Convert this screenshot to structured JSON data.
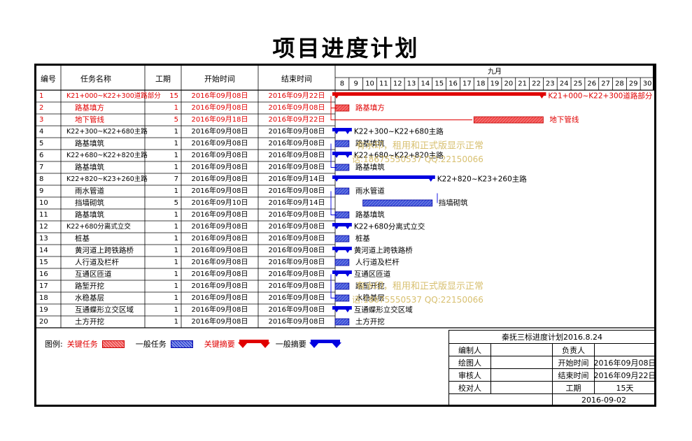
{
  "title": "项目进度计划",
  "headers": {
    "id": "编号",
    "name": "任务名称",
    "duration": "工期",
    "start": "开始时间",
    "end": "结束时间",
    "month": "九月"
  },
  "chart_data": {
    "type": "gantt",
    "days": [
      "8",
      "9",
      "10",
      "11",
      "12",
      "13",
      "14",
      "15",
      "16",
      "17",
      "18",
      "19",
      "20",
      "21",
      "22",
      "23",
      "24",
      "25",
      "26",
      "27",
      "28",
      "29",
      "30"
    ],
    "tasks": [
      {
        "id": "1",
        "name": "K21+000~K22+300道路部分",
        "duration": "15",
        "start": "2016年09月08日",
        "end": "2016年09月22日",
        "type": "critical-summary",
        "from": 8,
        "to": 22,
        "label": "K21+000~K22+300道路部分"
      },
      {
        "id": "2",
        "name": "路基填方",
        "duration": "1",
        "start": "2016年09月08日",
        "end": "2016年09月08日",
        "type": "critical",
        "from": 8,
        "to": 8,
        "label": "路基填方"
      },
      {
        "id": "3",
        "name": "地下管线",
        "duration": "5",
        "start": "2016年09月18日",
        "end": "2016年09月22日",
        "type": "critical",
        "from": 18,
        "to": 22,
        "label": "地下管线"
      },
      {
        "id": "4",
        "name": "K22+300~K22+680主路",
        "duration": "1",
        "start": "2016年09月08日",
        "end": "2016年09月08日",
        "type": "summary",
        "from": 8,
        "to": 8,
        "label": "K22+300~K22+680主路"
      },
      {
        "id": "5",
        "name": "路基填筑",
        "duration": "1",
        "start": "2016年09月08日",
        "end": "2016年09月08日",
        "type": "task",
        "from": 8,
        "to": 8,
        "label": "路基填筑"
      },
      {
        "id": "6",
        "name": "K22+680~K22+820主路",
        "duration": "1",
        "start": "2016年09月08日",
        "end": "2016年09月08日",
        "type": "summary",
        "from": 8,
        "to": 8,
        "label": "K22+680~K22+820主路"
      },
      {
        "id": "7",
        "name": "路基填筑",
        "duration": "1",
        "start": "2016年09月08日",
        "end": "2016年09月08日",
        "type": "task",
        "from": 8,
        "to": 8,
        "label": "路基填筑"
      },
      {
        "id": "8",
        "name": "K22+820~K23+260主路",
        "duration": "7",
        "start": "2016年09月08日",
        "end": "2016年09月14日",
        "type": "summary",
        "from": 8,
        "to": 14,
        "label": "K22+820~K23+260主路"
      },
      {
        "id": "9",
        "name": "雨水管道",
        "duration": "1",
        "start": "2016年09月08日",
        "end": "2016年09月08日",
        "type": "task",
        "from": 8,
        "to": 8,
        "label": "雨水管道"
      },
      {
        "id": "10",
        "name": "挡墙砌筑",
        "duration": "5",
        "start": "2016年09月10日",
        "end": "2016年09月14日",
        "type": "task",
        "from": 10,
        "to": 14,
        "label": "挡墙砌筑"
      },
      {
        "id": "11",
        "name": "路基填筑",
        "duration": "1",
        "start": "2016年09月08日",
        "end": "2016年09月08日",
        "type": "task",
        "from": 8,
        "to": 8,
        "label": "路基填筑"
      },
      {
        "id": "12",
        "name": "K22+680分离式立交",
        "duration": "1",
        "start": "2016年09月08日",
        "end": "2016年09月08日",
        "type": "summary",
        "from": 8,
        "to": 8,
        "label": "K22+680分离式立交"
      },
      {
        "id": "13",
        "name": "桩基",
        "duration": "1",
        "start": "2016年09月08日",
        "end": "2016年09月08日",
        "type": "task",
        "from": 8,
        "to": 8,
        "label": "桩基"
      },
      {
        "id": "14",
        "name": "黄河道上跨铁路桥",
        "duration": "1",
        "start": "2016年09月08日",
        "end": "2016年09月08日",
        "type": "summary",
        "from": 8,
        "to": 8,
        "label": "黄河道上跨铁路桥"
      },
      {
        "id": "15",
        "name": "人行道及栏杆",
        "duration": "1",
        "start": "2016年09月08日",
        "end": "2016年09月08日",
        "type": "task",
        "from": 8,
        "to": 8,
        "label": "人行道及栏杆"
      },
      {
        "id": "16",
        "name": "互通区匝道",
        "duration": "1",
        "start": "2016年09月08日",
        "end": "2016年09月08日",
        "type": "summary",
        "from": 8,
        "to": 8,
        "label": "互通区匝道"
      },
      {
        "id": "17",
        "name": "路堑开挖",
        "duration": "1",
        "start": "2016年09月08日",
        "end": "2016年09月08日",
        "type": "task",
        "from": 8,
        "to": 8,
        "label": "路堑开挖"
      },
      {
        "id": "18",
        "name": "水稳基层",
        "duration": "1",
        "start": "2016年09月08日",
        "end": "2016年09月08日",
        "type": "task",
        "from": 8,
        "to": 8,
        "label": "水稳基层"
      },
      {
        "id": "19",
        "name": "互通蝶形立交区域",
        "duration": "1",
        "start": "2016年09月08日",
        "end": "2016年09月08日",
        "type": "summary",
        "from": 8,
        "to": 8,
        "label": "互通蝶形立交区域"
      },
      {
        "id": "20",
        "name": "土方开挖",
        "duration": "1",
        "start": "2016年09月08日",
        "end": "2016年09月08日",
        "type": "task",
        "from": 8,
        "to": 8,
        "label": "土方开挖"
      }
    ],
    "colors": {
      "critical": "#e00000",
      "normal": "#0000e0",
      "watermark": "#d8c070"
    }
  },
  "legend": {
    "label": "图例:",
    "critical_task": "关键任务",
    "normal_task": "一般任务",
    "critical_summary": "关键摘要",
    "normal_summary": "一般摘要"
  },
  "info": {
    "project": "秦抚三标进度计划2016.8.24",
    "compiler_label": "编制人",
    "owner_label": "负责人",
    "drawer_label": "绘图人",
    "start_label": "开始时间",
    "start_value": "2016年09月08日",
    "reviewer_label": "审核人",
    "end_label": "结束时间",
    "end_value": "2016年09月22日",
    "checker_label": "校对人",
    "duration_label": "工期",
    "duration_value": "15天",
    "date": "2016-09-02"
  },
  "watermark": {
    "line1": "有水印，租用和正式版显示正常",
    "line2": "话:18675550537 QQ:22150066"
  }
}
